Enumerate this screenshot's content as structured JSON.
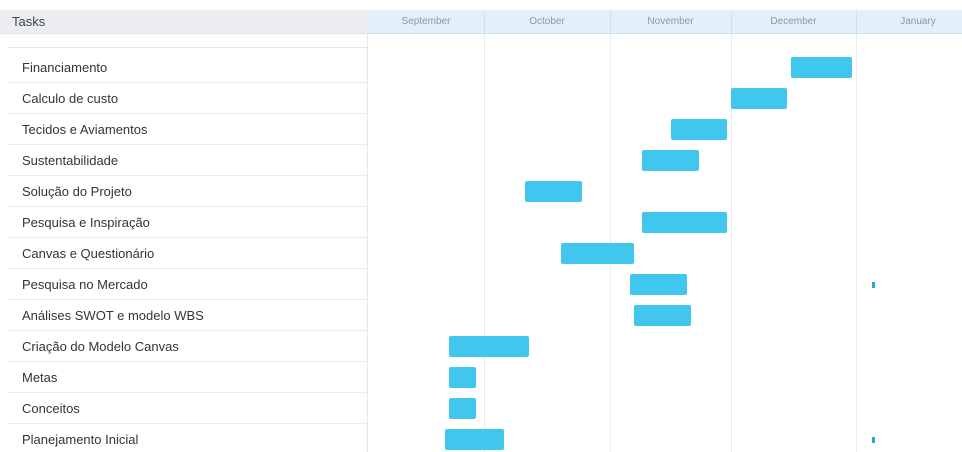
{
  "header": {
    "tasks_label": "Tasks"
  },
  "months": [
    "September",
    "October",
    "November",
    "December",
    "January"
  ],
  "tasks": [
    {
      "name": "Financiamento",
      "start": "2017-12-16",
      "end": "2017-12-31"
    },
    {
      "name": "Calculo de custo",
      "start": "2017-12-01",
      "end": "2017-12-15"
    },
    {
      "name": "Tecidos e Aviamentos",
      "start": "2017-11-16",
      "end": "2017-11-30"
    },
    {
      "name": "Sustentabilidade",
      "start": "2017-11-09",
      "end": "2017-11-23"
    },
    {
      "name": "Solução do Projeto",
      "start": "2017-10-11",
      "end": "2017-10-25"
    },
    {
      "name": "Pesquisa e Inspiração",
      "start": "2017-11-09",
      "end": "2017-11-30"
    },
    {
      "name": "Canvas e Questionário",
      "start": "2017-10-20",
      "end": "2017-11-07"
    },
    {
      "name": "Pesquisa no Mercado",
      "start": "2017-11-06",
      "end": "2017-11-20",
      "milestone": "2018-01-05"
    },
    {
      "name": "Análises SWOT e modelo WBS",
      "start": "2017-11-07",
      "end": "2017-11-21"
    },
    {
      "name": "Criação do Modelo Canvas",
      "start": "2017-09-22",
      "end": "2017-10-12"
    },
    {
      "name": "Metas",
      "start": "2017-09-22",
      "end": "2017-09-29"
    },
    {
      "name": "Conceitos",
      "start": "2017-09-22",
      "end": "2017-09-29"
    },
    {
      "name": "Planejamento Inicial",
      "start": "2017-09-21",
      "end": "2017-10-06",
      "milestone": "2018-01-05"
    }
  ],
  "colors": {
    "bar": "#41c6ee",
    "milestone": "#2aa6d8",
    "timeline_header": "#e1f0fa",
    "task_header": "#ebedf0"
  }
}
